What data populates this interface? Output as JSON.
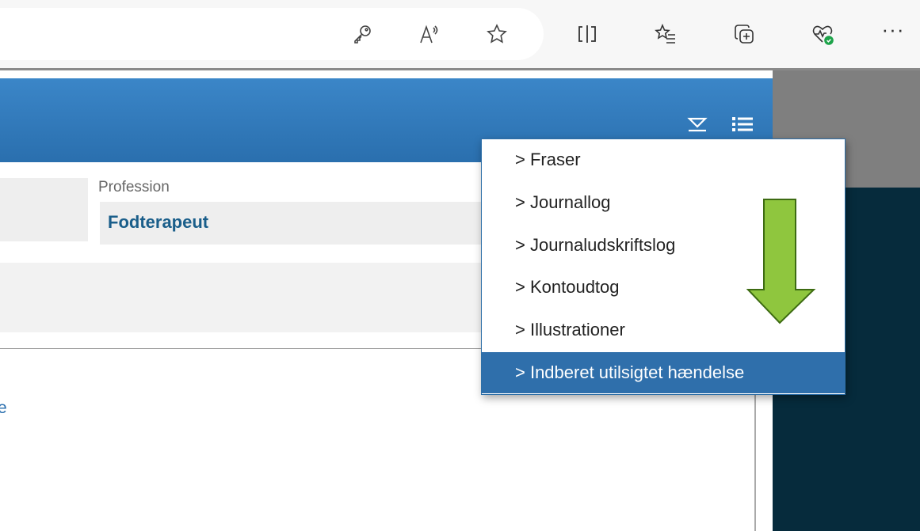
{
  "browser": {
    "icons": [
      "key-icon",
      "read-aloud-icon",
      "favorite-star-icon",
      "split-screen-icon",
      "favorites-list-icon",
      "collections-icon",
      "health-icon",
      "more-icon"
    ],
    "more_label": "···"
  },
  "app": {
    "header_icons": [
      "collapse-icon",
      "menu-list-icon"
    ],
    "profession_label": "Profession",
    "profession_value": "Fodterapeut",
    "stray_text": "e"
  },
  "menu": {
    "items": [
      {
        "label": "> Fraser",
        "active": false
      },
      {
        "label": "> Journallog",
        "active": false
      },
      {
        "label": "> Journaludskriftslog",
        "active": false
      },
      {
        "label": "> Kontoudtog",
        "active": false
      },
      {
        "label": "> Illustrationer",
        "active": false
      },
      {
        "label": "> Indberet utilsigtet hændelse",
        "active": true
      }
    ]
  },
  "colors": {
    "header_blue": "#2f74b5",
    "menu_active": "#2f6fab",
    "profession_text": "#1a5e8a",
    "arrow_fill": "#8fc63e",
    "dark_panel": "#062b3c"
  }
}
